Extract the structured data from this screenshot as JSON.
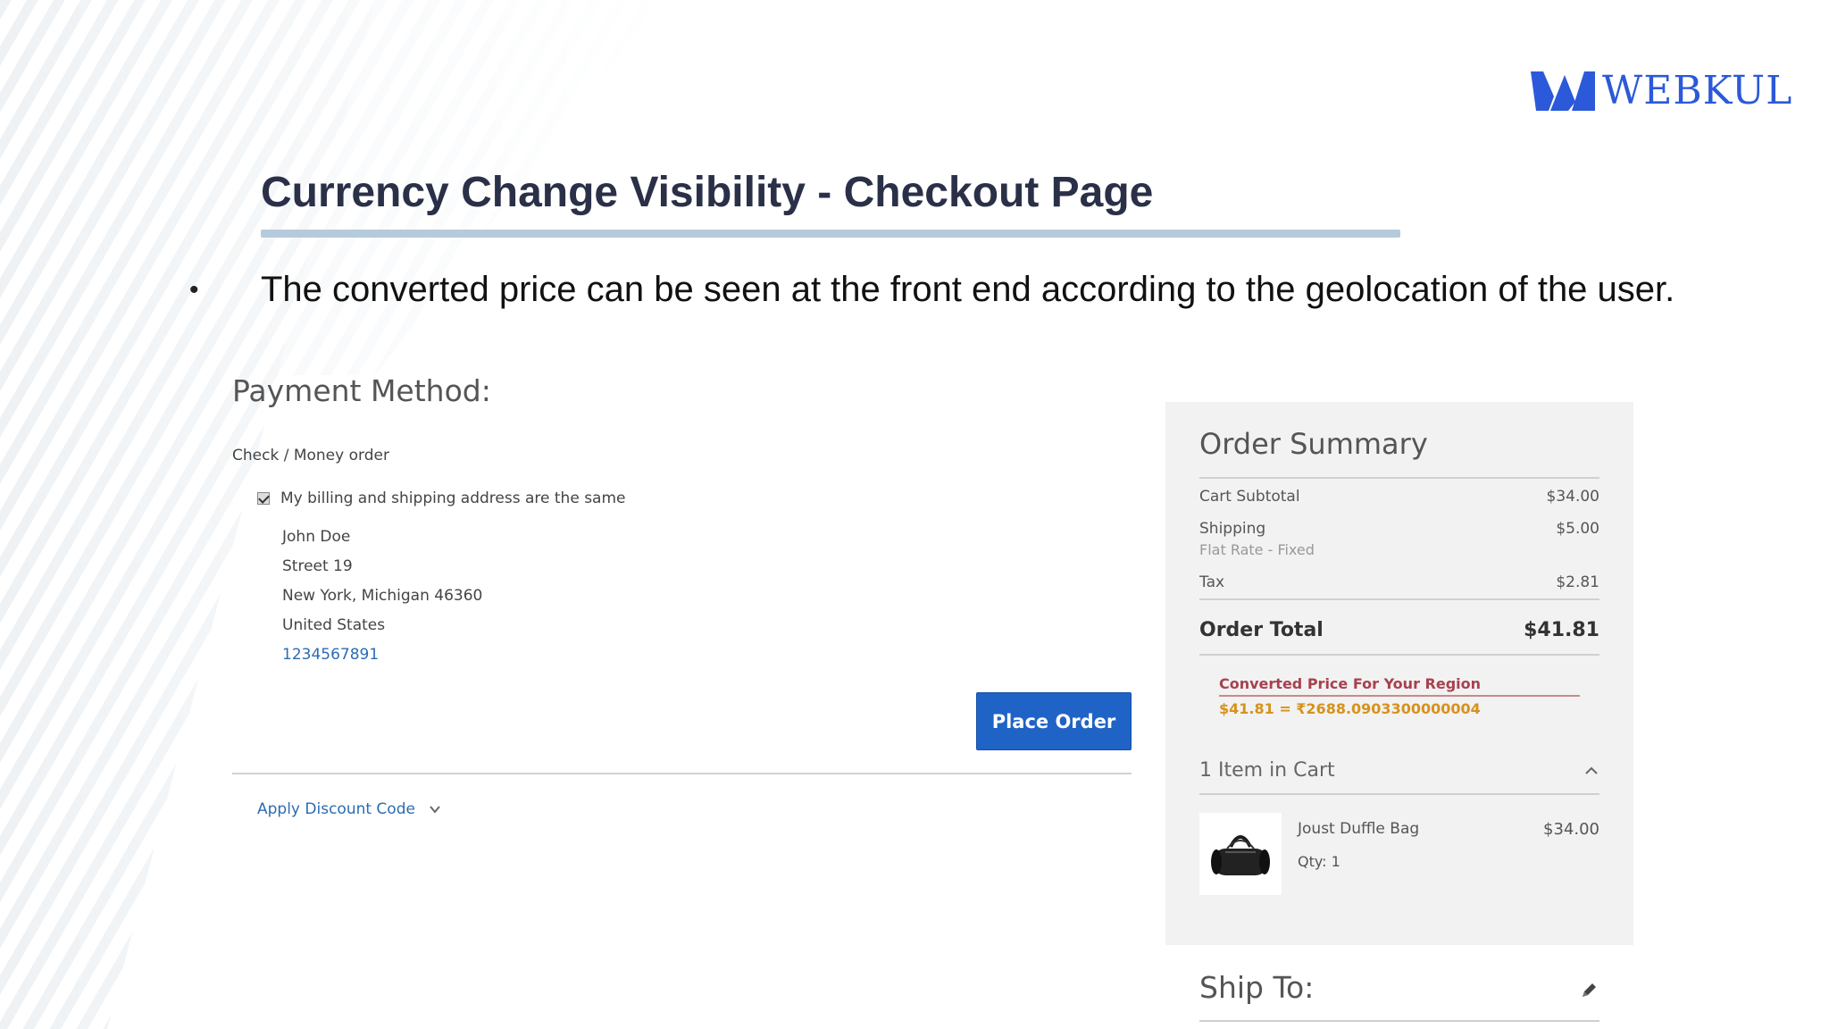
{
  "slide": {
    "brand": "WEBKUL",
    "title": "Currency Change Visibility - Checkout Page",
    "bullet": "•",
    "bullet_text": "The converted price can be seen at the front end according to the geolocation of the user."
  },
  "payment": {
    "title": "Payment Method:",
    "method": "Check / Money order",
    "same_address_label": "My billing and shipping address are the same",
    "same_address_checked": true,
    "address": {
      "name": "John Doe",
      "street": "Street 19",
      "city_line": "New York, Michigan 46360",
      "country": "United States",
      "phone": "1234567891"
    },
    "place_order_label": "Place Order",
    "discount_label": "Apply Discount Code"
  },
  "summary": {
    "title": "Order Summary",
    "rows": [
      {
        "label": "Cart Subtotal",
        "value": "$34.00"
      },
      {
        "label": "Shipping",
        "value": "$5.00",
        "sub": "Flat Rate - Fixed"
      },
      {
        "label": "Tax",
        "value": "$2.81"
      }
    ],
    "total_label": "Order Total",
    "total_value": "$41.81",
    "converted_label": "Converted Price For Your Region",
    "converted_value": "$41.81 = ₹2688.0903300000004",
    "items_label": "1 Item in Cart",
    "item": {
      "name": "Joust Duffle Bag",
      "qty": "Qty: 1",
      "price": "$34.00",
      "thumb_icon": "duffle-bag-icon"
    }
  },
  "ship_to": {
    "title": "Ship To:",
    "edit_icon": "pencil-icon"
  },
  "colors": {
    "brand_blue": "#2b59d9",
    "button_blue": "#1f63c6",
    "converted_label": "#a8414f",
    "converted_value": "#d7921b",
    "title_text": "#2a3048"
  }
}
